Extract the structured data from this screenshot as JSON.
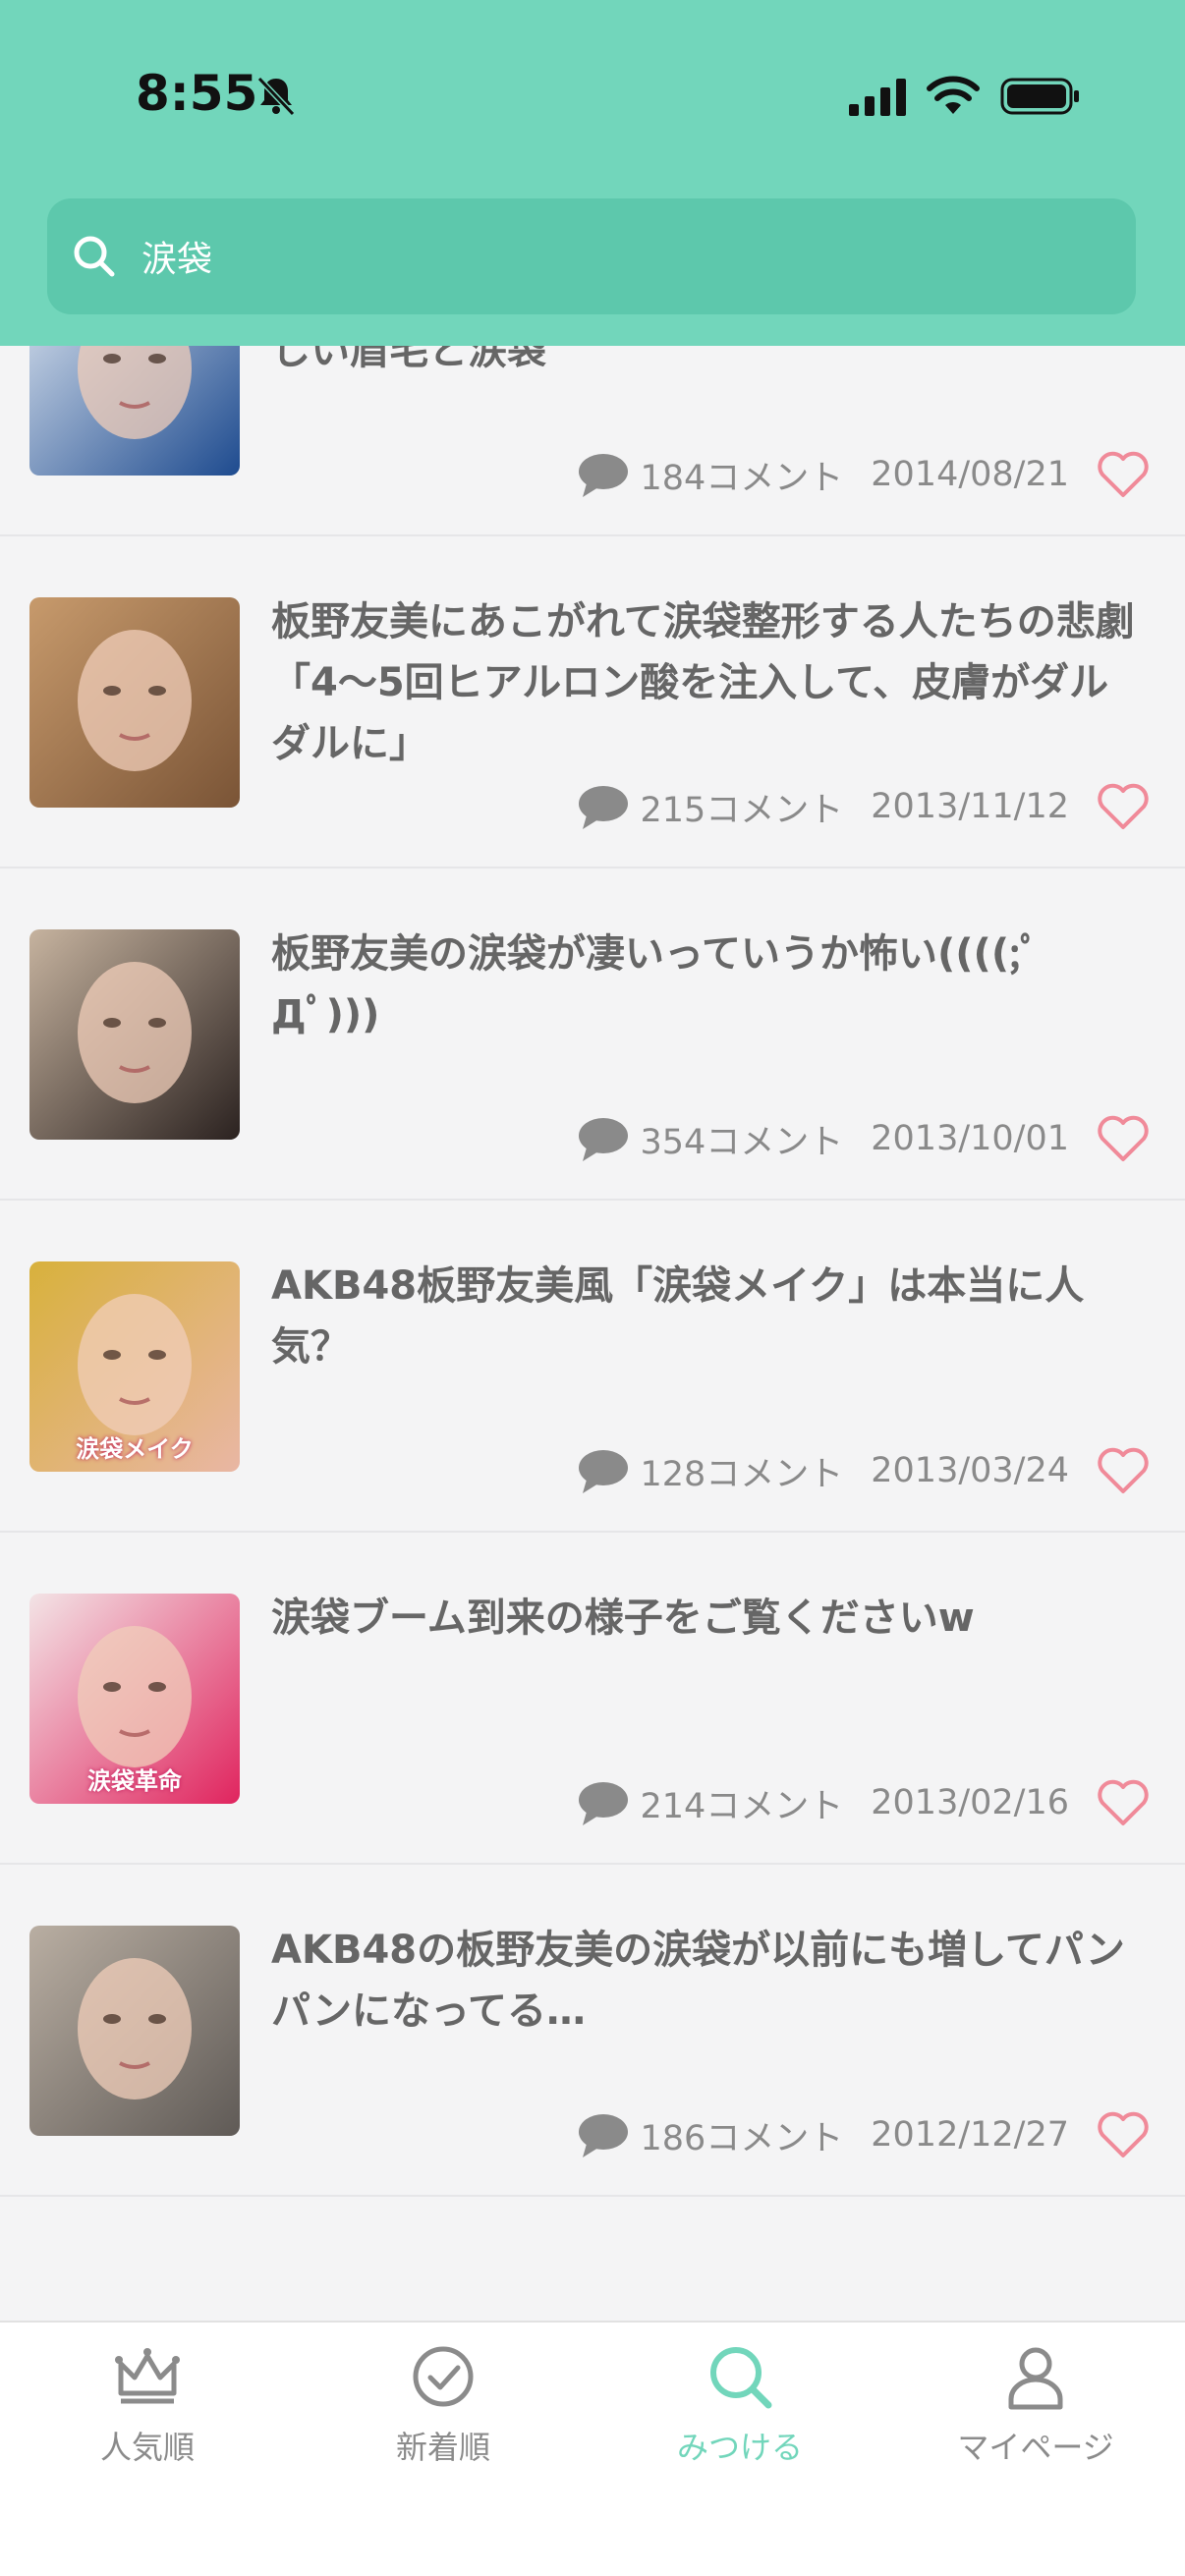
{
  "status_bar": {
    "time": "8:55"
  },
  "search": {
    "value": "涙袋"
  },
  "articles": [
    {
      "title": "さわらん新作は“松坂桃李”風、ポイントは男らしい眉毛と涙袋",
      "comments": "184コメント",
      "date": "2014/08/21",
      "thumb_colors": [
        "#dfe7f1",
        "#1e4b8f"
      ]
    },
    {
      "title": "板野友美にあこがれて涙袋整形する人たちの悲劇「4〜5回ヒアルロン酸を注入して、皮膚がダルダルに」",
      "comments": "215コメント",
      "date": "2013/11/12",
      "thumb_colors": [
        "#c79a6c",
        "#7a5436"
      ]
    },
    {
      "title": "板野友美の涙袋が凄いっていうか怖い((((;ﾟДﾟ)))",
      "comments": "354コメント",
      "date": "2013/10/01",
      "thumb_colors": [
        "#c6b39f",
        "#2b2220"
      ]
    },
    {
      "title": "AKB48板野友美風「涙袋メイク」は本当に人気？",
      "comments": "128コメント",
      "date": "2013/03/24",
      "thumb_colors": [
        "#d8b13c",
        "#e9b6a4"
      ],
      "thumb_text": "涙袋メイク"
    },
    {
      "title": "涙袋ブーム到来の様子をご覧くださいw",
      "comments": "214コメント",
      "date": "2013/02/16",
      "thumb_colors": [
        "#f3e4e6",
        "#e0245e"
      ],
      "thumb_text": "涙袋革命"
    },
    {
      "title": "AKB48の板野友美の涙袋が以前にも増してパンパンになってる…",
      "comments": "186コメント",
      "date": "2012/12/27",
      "thumb_colors": [
        "#b9aea2",
        "#5f5a56"
      ]
    }
  ],
  "tabs": [
    {
      "label": "人気順",
      "icon": "crown-icon",
      "active": false
    },
    {
      "label": "新着順",
      "icon": "clock-icon",
      "active": false
    },
    {
      "label": "みつける",
      "icon": "search-icon",
      "active": true
    },
    {
      "label": "マイページ",
      "icon": "person-icon",
      "active": false
    }
  ],
  "colors": {
    "accent": "#72d6bb",
    "accent_dark": "#5dc8ac",
    "heart": "#f08a99",
    "inactive": "#8b8b8b"
  }
}
